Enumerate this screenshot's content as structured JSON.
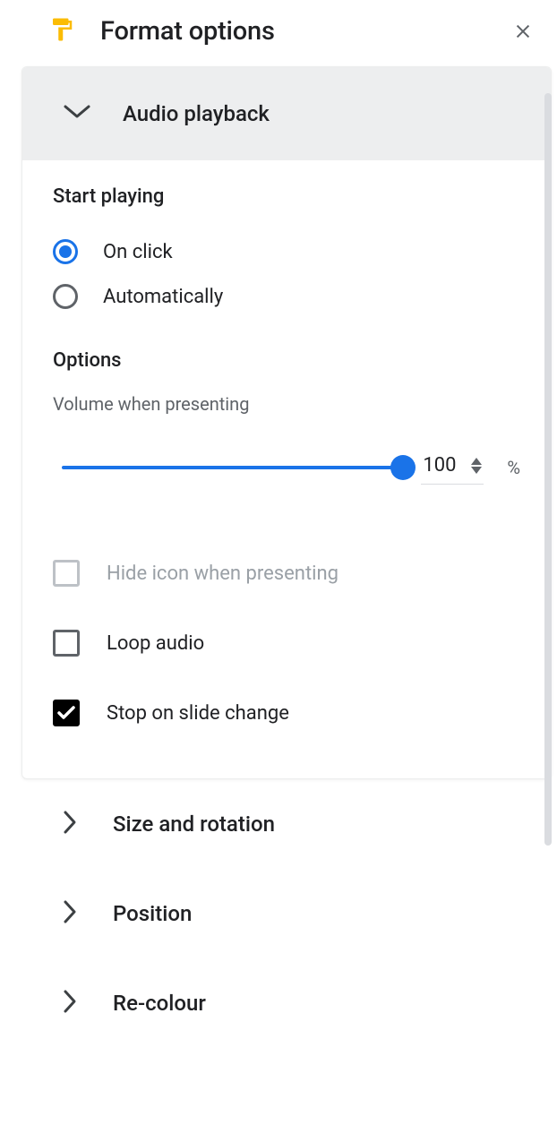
{
  "header": {
    "title": "Format options"
  },
  "sections": {
    "audio_playback": {
      "title": "Audio playback",
      "start_playing": {
        "heading": "Start playing",
        "on_click": "On click",
        "automatically": "Automatically",
        "selected": "on_click"
      },
      "options": {
        "heading": "Options",
        "volume_label": "Volume when presenting",
        "volume_value": "100",
        "volume_unit": "%",
        "hide_icon": "Hide icon when presenting",
        "loop_audio": "Loop audio",
        "stop_on_slide_change": "Stop on slide change",
        "checked": {
          "hide_icon": false,
          "loop_audio": false,
          "stop_on_slide_change": true
        },
        "disabled": {
          "hide_icon": true
        }
      }
    },
    "size_rotation": {
      "title": "Size and rotation"
    },
    "position": {
      "title": "Position"
    },
    "recolour": {
      "title": "Re-colour"
    }
  }
}
